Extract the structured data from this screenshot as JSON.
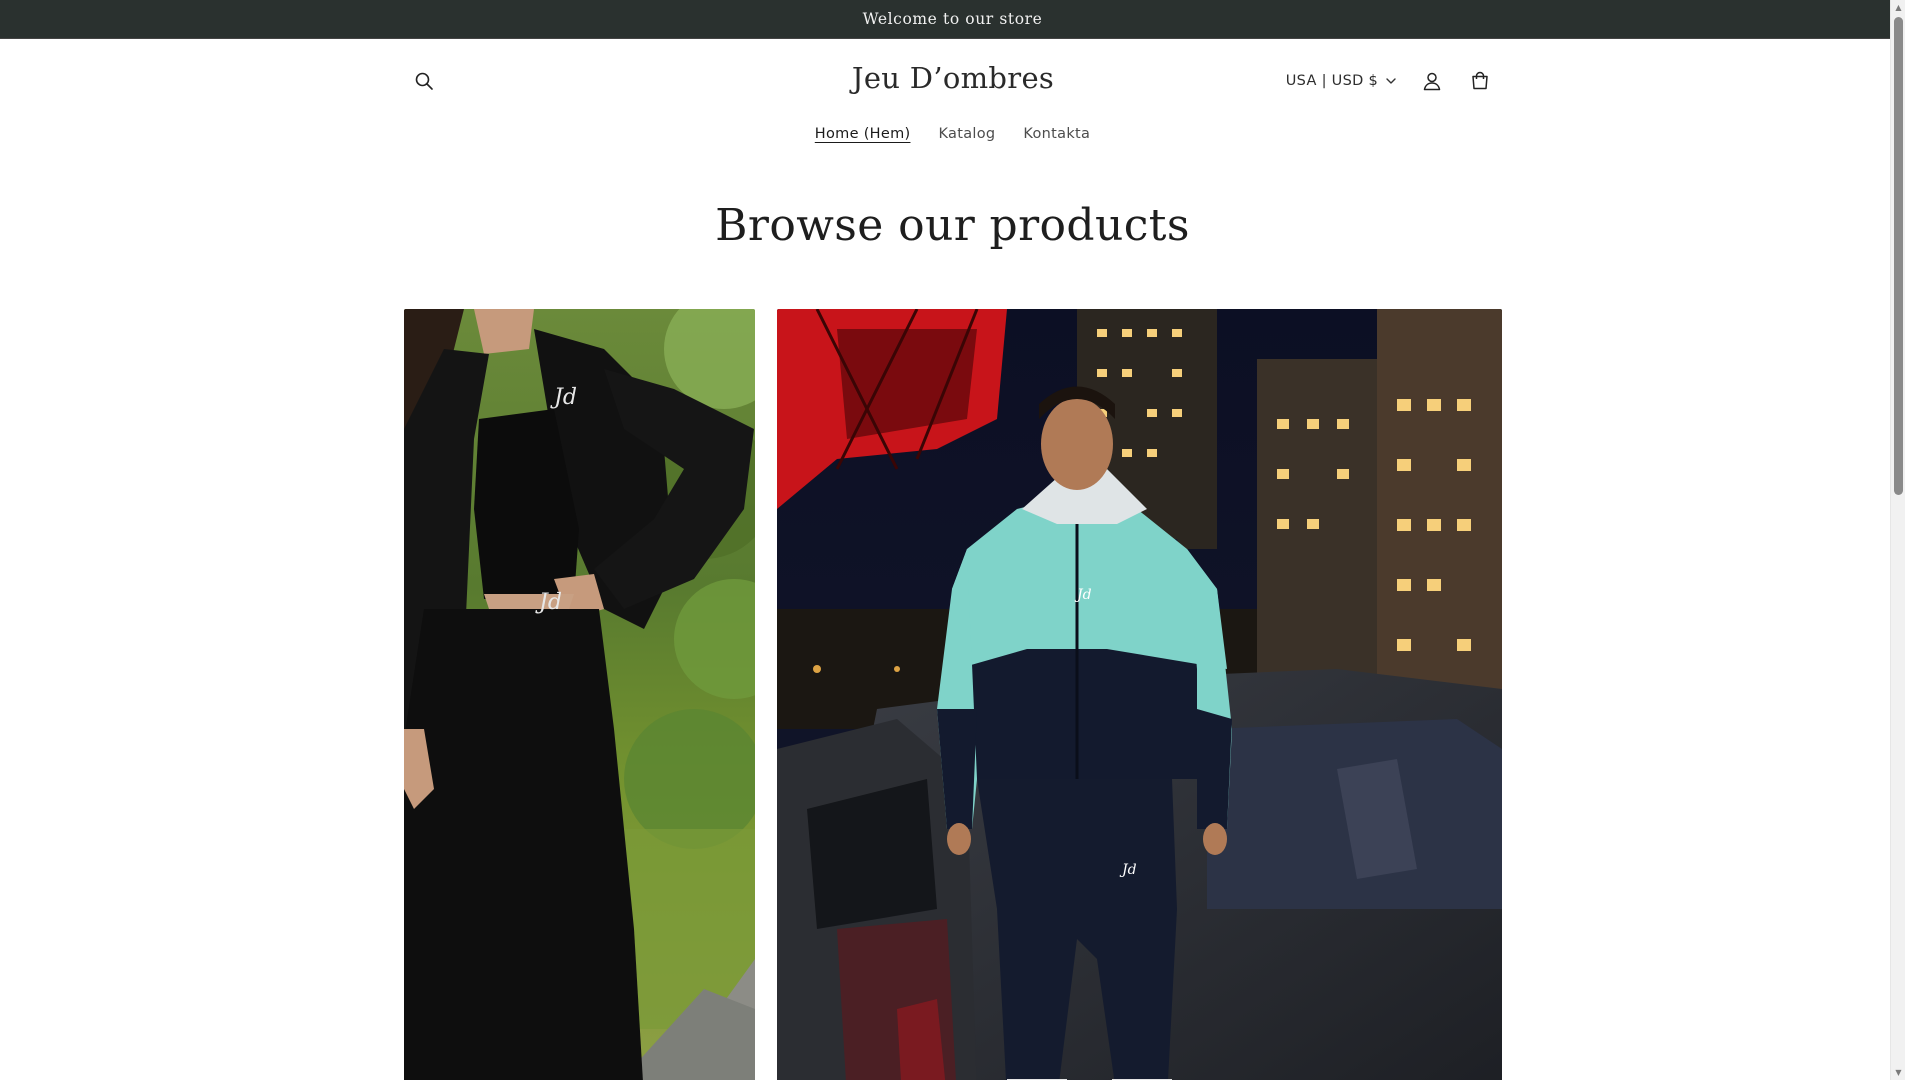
{
  "announcement": {
    "text": "Welcome to our store"
  },
  "header": {
    "logo": "Jeu D’ombres",
    "currency": "USA | USD $",
    "icons": [
      "search-icon",
      "user-icon",
      "cart-icon",
      "chevron-down-icon"
    ]
  },
  "nav": {
    "items": [
      {
        "label": "Home (Hem)"
      },
      {
        "label": "Katalog"
      },
      {
        "label": "Kontakta"
      }
    ]
  },
  "main": {
    "title": "Browse our products"
  },
  "colors": {
    "announcement_bg": "#2a312f",
    "text": "#121212",
    "background": "#ffffff"
  }
}
